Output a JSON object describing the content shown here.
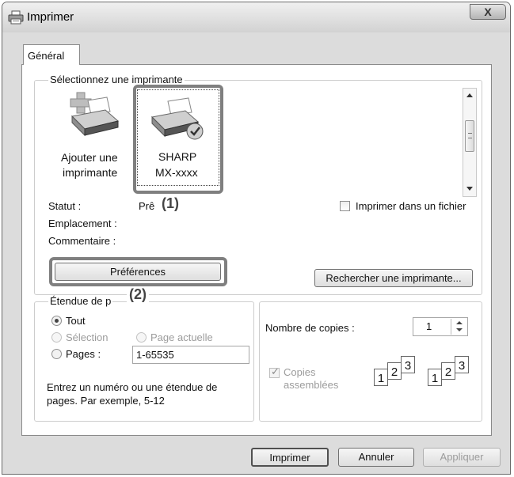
{
  "window": {
    "title": "Imprimer",
    "close_glyph": "X"
  },
  "tabs": [
    {
      "label": "Général",
      "selected": true
    }
  ],
  "printer_group": {
    "label": "Sélectionnez une imprimante",
    "printers": [
      {
        "line1": "Ajouter une",
        "line2": "imprimante",
        "icon": "add-printer-icon",
        "selected": false
      },
      {
        "line1": "SHARP",
        "line2": "MX-xxxx",
        "icon": "default-printer-icon",
        "selected": true
      }
    ],
    "status_label": "Statut :",
    "status_value": "Prê",
    "location_label": "Emplacement :",
    "comment_label": "Commentaire :",
    "print_to_file_label": "Imprimer dans un fichier",
    "preferences_button": "Préférences",
    "find_printer_button": "Rechercher une imprimante..."
  },
  "range_group": {
    "label": "Étendue de p",
    "all_label": "Tout",
    "selection_label": "Sélection",
    "current_page_label": "Page actuelle",
    "pages_label": "Pages :",
    "pages_value": "1-65535",
    "hint": "Entrez un numéro ou une étendue de pages. Par exemple, 5-12"
  },
  "copies_group": {
    "copies_label": "Nombre de copies :",
    "copies_value": "1",
    "collate_label_line1": "Copies",
    "collate_label_line2": "assemblées",
    "collate_checked": true,
    "collate_sheets": [
      "1",
      "2",
      "3"
    ]
  },
  "footer_buttons": {
    "print": "Imprimer",
    "cancel": "Annuler",
    "apply": "Appliquer"
  },
  "callouts": {
    "one": "(1)",
    "two": "(2)"
  }
}
